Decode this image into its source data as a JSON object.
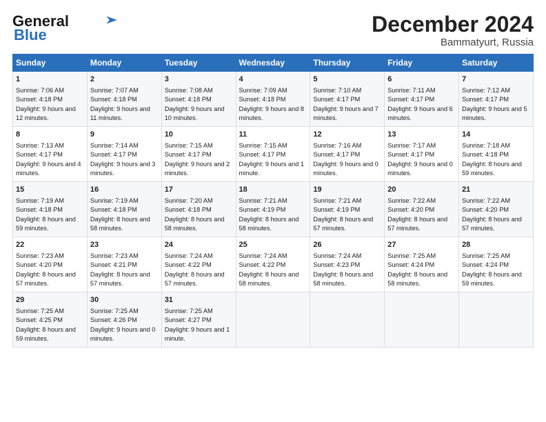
{
  "header": {
    "logo_line1": "General",
    "logo_line2": "Blue",
    "month": "December 2024",
    "location": "Bammatyurt, Russia"
  },
  "weekdays": [
    "Sunday",
    "Monday",
    "Tuesday",
    "Wednesday",
    "Thursday",
    "Friday",
    "Saturday"
  ],
  "weeks": [
    [
      {
        "day": "1",
        "lines": [
          "Sunrise: 7:06 AM",
          "Sunset: 4:18 PM",
          "Daylight: 9 hours",
          "and 12 minutes."
        ]
      },
      {
        "day": "2",
        "lines": [
          "Sunrise: 7:07 AM",
          "Sunset: 4:18 PM",
          "Daylight: 9 hours",
          "and 11 minutes."
        ]
      },
      {
        "day": "3",
        "lines": [
          "Sunrise: 7:08 AM",
          "Sunset: 4:18 PM",
          "Daylight: 9 hours",
          "and 10 minutes."
        ]
      },
      {
        "day": "4",
        "lines": [
          "Sunrise: 7:09 AM",
          "Sunset: 4:18 PM",
          "Daylight: 9 hours",
          "and 8 minutes."
        ]
      },
      {
        "day": "5",
        "lines": [
          "Sunrise: 7:10 AM",
          "Sunset: 4:17 PM",
          "Daylight: 9 hours",
          "and 7 minutes."
        ]
      },
      {
        "day": "6",
        "lines": [
          "Sunrise: 7:11 AM",
          "Sunset: 4:17 PM",
          "Daylight: 9 hours",
          "and 6 minutes."
        ]
      },
      {
        "day": "7",
        "lines": [
          "Sunrise: 7:12 AM",
          "Sunset: 4:17 PM",
          "Daylight: 9 hours",
          "and 5 minutes."
        ]
      }
    ],
    [
      {
        "day": "8",
        "lines": [
          "Sunrise: 7:13 AM",
          "Sunset: 4:17 PM",
          "Daylight: 9 hours",
          "and 4 minutes."
        ]
      },
      {
        "day": "9",
        "lines": [
          "Sunrise: 7:14 AM",
          "Sunset: 4:17 PM",
          "Daylight: 9 hours",
          "and 3 minutes."
        ]
      },
      {
        "day": "10",
        "lines": [
          "Sunrise: 7:15 AM",
          "Sunset: 4:17 PM",
          "Daylight: 9 hours",
          "and 2 minutes."
        ]
      },
      {
        "day": "11",
        "lines": [
          "Sunrise: 7:15 AM",
          "Sunset: 4:17 PM",
          "Daylight: 9 hours",
          "and 1 minute."
        ]
      },
      {
        "day": "12",
        "lines": [
          "Sunrise: 7:16 AM",
          "Sunset: 4:17 PM",
          "Daylight: 9 hours",
          "and 0 minutes."
        ]
      },
      {
        "day": "13",
        "lines": [
          "Sunrise: 7:17 AM",
          "Sunset: 4:17 PM",
          "Daylight: 9 hours",
          "and 0 minutes."
        ]
      },
      {
        "day": "14",
        "lines": [
          "Sunrise: 7:18 AM",
          "Sunset: 4:18 PM",
          "Daylight: 8 hours",
          "and 59 minutes."
        ]
      }
    ],
    [
      {
        "day": "15",
        "lines": [
          "Sunrise: 7:19 AM",
          "Sunset: 4:18 PM",
          "Daylight: 8 hours",
          "and 59 minutes."
        ]
      },
      {
        "day": "16",
        "lines": [
          "Sunrise: 7:19 AM",
          "Sunset: 4:18 PM",
          "Daylight: 8 hours",
          "and 58 minutes."
        ]
      },
      {
        "day": "17",
        "lines": [
          "Sunrise: 7:20 AM",
          "Sunset: 4:18 PM",
          "Daylight: 8 hours",
          "and 58 minutes."
        ]
      },
      {
        "day": "18",
        "lines": [
          "Sunrise: 7:21 AM",
          "Sunset: 4:19 PM",
          "Daylight: 8 hours",
          "and 58 minutes."
        ]
      },
      {
        "day": "19",
        "lines": [
          "Sunrise: 7:21 AM",
          "Sunset: 4:19 PM",
          "Daylight: 8 hours",
          "and 57 minutes."
        ]
      },
      {
        "day": "20",
        "lines": [
          "Sunrise: 7:22 AM",
          "Sunset: 4:20 PM",
          "Daylight: 8 hours",
          "and 57 minutes."
        ]
      },
      {
        "day": "21",
        "lines": [
          "Sunrise: 7:22 AM",
          "Sunset: 4:20 PM",
          "Daylight: 8 hours",
          "and 57 minutes."
        ]
      }
    ],
    [
      {
        "day": "22",
        "lines": [
          "Sunrise: 7:23 AM",
          "Sunset: 4:20 PM",
          "Daylight: 8 hours",
          "and 57 minutes."
        ]
      },
      {
        "day": "23",
        "lines": [
          "Sunrise: 7:23 AM",
          "Sunset: 4:21 PM",
          "Daylight: 8 hours",
          "and 57 minutes."
        ]
      },
      {
        "day": "24",
        "lines": [
          "Sunrise: 7:24 AM",
          "Sunset: 4:22 PM",
          "Daylight: 8 hours",
          "and 57 minutes."
        ]
      },
      {
        "day": "25",
        "lines": [
          "Sunrise: 7:24 AM",
          "Sunset: 4:22 PM",
          "Daylight: 8 hours",
          "and 58 minutes."
        ]
      },
      {
        "day": "26",
        "lines": [
          "Sunrise: 7:24 AM",
          "Sunset: 4:23 PM",
          "Daylight: 8 hours",
          "and 58 minutes."
        ]
      },
      {
        "day": "27",
        "lines": [
          "Sunrise: 7:25 AM",
          "Sunset: 4:24 PM",
          "Daylight: 8 hours",
          "and 58 minutes."
        ]
      },
      {
        "day": "28",
        "lines": [
          "Sunrise: 7:25 AM",
          "Sunset: 4:24 PM",
          "Daylight: 8 hours",
          "and 59 minutes."
        ]
      }
    ],
    [
      {
        "day": "29",
        "lines": [
          "Sunrise: 7:25 AM",
          "Sunset: 4:25 PM",
          "Daylight: 8 hours",
          "and 59 minutes."
        ]
      },
      {
        "day": "30",
        "lines": [
          "Sunrise: 7:25 AM",
          "Sunset: 4:26 PM",
          "Daylight: 9 hours",
          "and 0 minutes."
        ]
      },
      {
        "day": "31",
        "lines": [
          "Sunrise: 7:25 AM",
          "Sunset: 4:27 PM",
          "Daylight: 9 hours",
          "and 1 minute."
        ]
      },
      null,
      null,
      null,
      null
    ]
  ]
}
